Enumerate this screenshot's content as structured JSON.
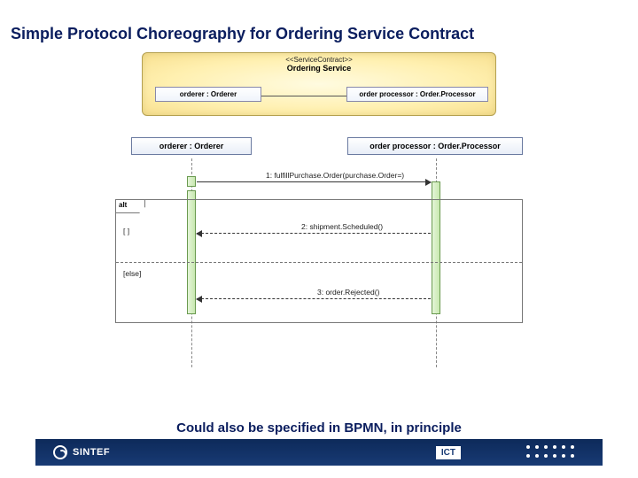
{
  "title": "Simple Protocol Choreography for Ordering Service Contract",
  "contract": {
    "stereotype": "<<ServiceContract>>",
    "name": "Ordering Service",
    "role_a": "orderer : Orderer",
    "role_b": "order processor : Order.Processor"
  },
  "lifelines": {
    "a": "orderer : Orderer",
    "b": "order processor : Order.Processor"
  },
  "messages": {
    "m1": "1: fulfillPurchase.Order(purchase.Order=)",
    "m2": "2: shipment.Scheduled()",
    "m3": "3: order.Rejected()"
  },
  "frame": {
    "tag": "alt",
    "guard1": "[ ]",
    "guard2": "[else]"
  },
  "caption": "Could also be specified in BPMN, in principle",
  "footer": {
    "brand": "SINTEF",
    "unit": "ICT"
  }
}
